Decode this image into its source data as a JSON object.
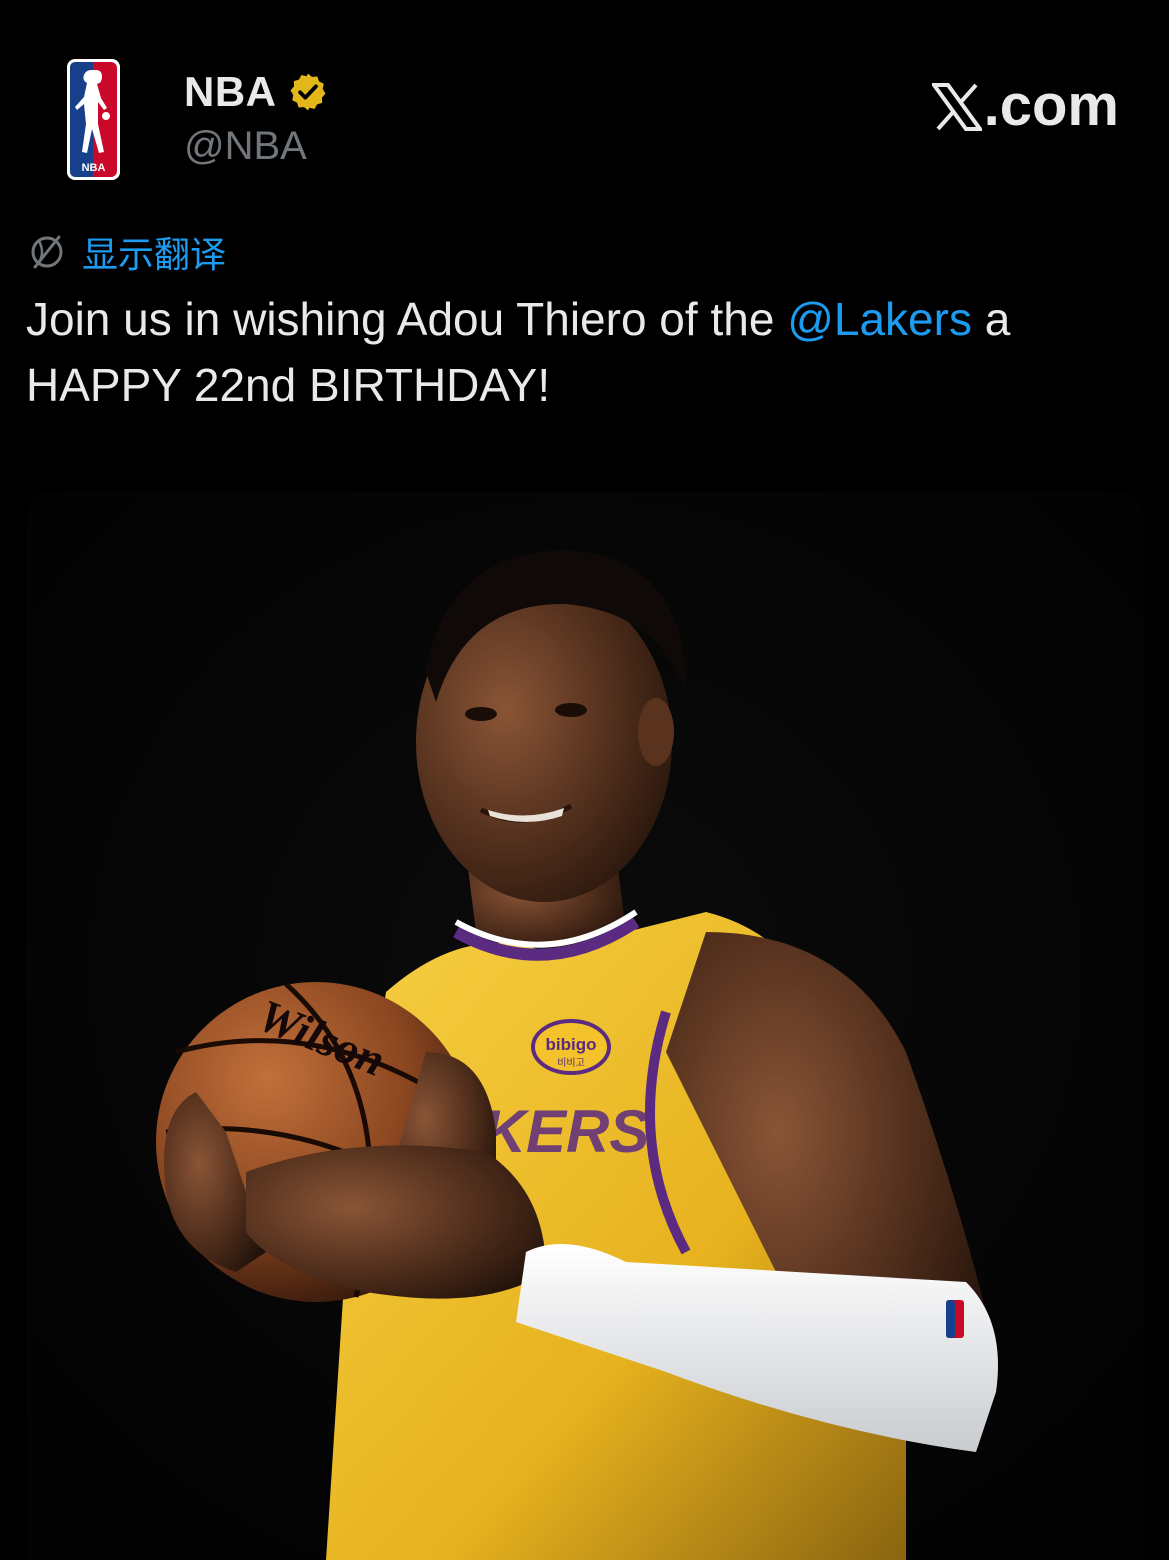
{
  "colors": {
    "background": "#000000",
    "text": "#e7e9ea",
    "secondary_text": "#71767b",
    "link": "#1d9bf0",
    "verified_gold": "#e2b719",
    "jersey_yellow": "#f4c22a",
    "jersey_purple": "#5b2b82"
  },
  "header": {
    "avatar_icon": "nba-logo-icon",
    "display_name": "NBA",
    "verified_icon": "verified-gold-badge-icon",
    "handle": "@NBA",
    "brand_icon": "x-logo-icon",
    "brand_suffix": ".com"
  },
  "translate": {
    "icon": "globe-icon",
    "label": "显示翻译"
  },
  "tweet": {
    "text_before_mention": "Join us in wishing Adou Thiero of the ",
    "mention": "@Lakers",
    "text_after_mention": " a HAPPY 22nd BIRTHDAY!"
  },
  "media": {
    "ball_brand": "Wilson",
    "jersey_patch": "bibigo",
    "jersey_patch_sub": "비비고",
    "jersey_wordmark": "LAKERS"
  }
}
